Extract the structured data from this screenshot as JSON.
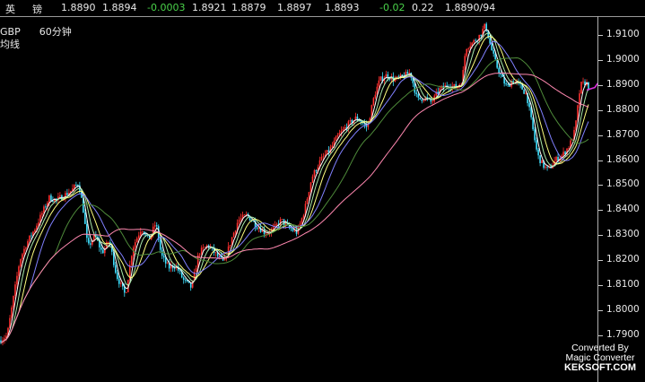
{
  "quote_bar": {
    "fields": [
      {
        "text": "英",
        "color": "#e8e8e8"
      },
      {
        "text": "镑",
        "color": "#e8e8e8"
      },
      {
        "text": "1.8890",
        "color": "#e8e8e8"
      },
      {
        "text": "1.8894",
        "color": "#e8e8e8"
      },
      {
        "text": "-0.0003",
        "color": "#4ad24a"
      },
      {
        "text": "1.8921",
        "color": "#e8e8e8"
      },
      {
        "text": "1.8879",
        "color": "#e8e8e8"
      },
      {
        "text": "1.8897",
        "color": "#e8e8e8"
      },
      {
        "text": "1.8893",
        "color": "#e8e8e8"
      },
      {
        "text": "-0.02",
        "color": "#4ad24a"
      },
      {
        "text": "0.22",
        "color": "#e8e8e8"
      },
      {
        "text": "1.8890/94",
        "color": "#e8e8e8"
      }
    ]
  },
  "chart_title": {
    "symbol": "GBP",
    "period": "60分钟",
    "indicator": "均线"
  },
  "watermark": {
    "line1": "Converted By",
    "line2": "Magic Converter",
    "line3": "KEKSOFT.COM"
  },
  "colors": {
    "background": "#000000",
    "up_candle": "#ff3030",
    "down_candle": "#40e0ff",
    "ma_fast": "#ffffff",
    "ma_2": "#a8e8a8",
    "ma_3": "#ffff80",
    "ma_4": "#8080ff",
    "ma_5": "#4e8a3a",
    "ma_6": "#ff88b0",
    "forecast_arrow": "#e030e0",
    "axis_text": "#e8e8e8"
  },
  "chart_data": {
    "type": "line",
    "title": "",
    "xlabel": "",
    "ylabel": "",
    "ylim": [
      1.7875,
      1.9175
    ],
    "y_ticks": [
      "1.9100",
      "1.9000",
      "1.8900",
      "1.8800",
      "1.8700",
      "1.8600",
      "1.8500",
      "1.8400",
      "1.8300",
      "1.8200",
      "1.8100",
      "1.8000",
      "1.7900"
    ],
    "grid": false,
    "candles_sample": "hourly OHLC bars approximated from price path",
    "price_path": [
      [
        0,
        1.788
      ],
      [
        8,
        1.79
      ],
      [
        15,
        1.805
      ],
      [
        22,
        1.82
      ],
      [
        30,
        1.827
      ],
      [
        38,
        1.832
      ],
      [
        46,
        1.838
      ],
      [
        55,
        1.845
      ],
      [
        63,
        1.844
      ],
      [
        72,
        1.846
      ],
      [
        80,
        1.848
      ],
      [
        88,
        1.851
      ],
      [
        93,
        1.84
      ],
      [
        98,
        1.825
      ],
      [
        106,
        1.83
      ],
      [
        114,
        1.823
      ],
      [
        122,
        1.828
      ],
      [
        130,
        1.814
      ],
      [
        140,
        1.806
      ],
      [
        148,
        1.825
      ],
      [
        158,
        1.833
      ],
      [
        166,
        1.828
      ],
      [
        174,
        1.835
      ],
      [
        180,
        1.822
      ],
      [
        188,
        1.817
      ],
      [
        196,
        1.818
      ],
      [
        205,
        1.812
      ],
      [
        214,
        1.809
      ],
      [
        222,
        1.823
      ],
      [
        232,
        1.826
      ],
      [
        242,
        1.822
      ],
      [
        250,
        1.819
      ],
      [
        258,
        1.828
      ],
      [
        266,
        1.836
      ],
      [
        276,
        1.838
      ],
      [
        286,
        1.834
      ],
      [
        296,
        1.831
      ],
      [
        304,
        1.832
      ],
      [
        314,
        1.836
      ],
      [
        322,
        1.833
      ],
      [
        332,
        1.831
      ],
      [
        340,
        1.84
      ],
      [
        348,
        1.853
      ],
      [
        358,
        1.86
      ],
      [
        368,
        1.864
      ],
      [
        378,
        1.87
      ],
      [
        388,
        1.874
      ],
      [
        398,
        1.877
      ],
      [
        410,
        1.873
      ],
      [
        418,
        1.886
      ],
      [
        424,
        1.892
      ],
      [
        432,
        1.894
      ],
      [
        440,
        1.892
      ],
      [
        448,
        1.893
      ],
      [
        458,
        1.895
      ],
      [
        466,
        1.884
      ],
      [
        474,
        1.885
      ],
      [
        482,
        1.883
      ],
      [
        490,
        1.888
      ],
      [
        500,
        1.89
      ],
      [
        510,
        1.889
      ],
      [
        516,
        1.892
      ],
      [
        520,
        1.905
      ],
      [
        528,
        1.907
      ],
      [
        536,
        1.91
      ],
      [
        542,
        1.914
      ],
      [
        548,
        1.905
      ],
      [
        554,
        1.898
      ],
      [
        560,
        1.893
      ],
      [
        566,
        1.889
      ],
      [
        572,
        1.892
      ],
      [
        580,
        1.89
      ],
      [
        588,
        1.886
      ],
      [
        594,
        1.874
      ],
      [
        600,
        1.862
      ],
      [
        606,
        1.858
      ],
      [
        612,
        1.856
      ],
      [
        620,
        1.86
      ],
      [
        628,
        1.862
      ],
      [
        636,
        1.866
      ],
      [
        642,
        1.872
      ],
      [
        648,
        1.89
      ],
      [
        654,
        1.891
      ],
      [
        658,
        1.889
      ]
    ],
    "series": [
      {
        "type": "ma",
        "color_key": "ma_fast",
        "smoothing": 3
      },
      {
        "type": "ma",
        "color_key": "ma_2",
        "smoothing": 6
      },
      {
        "type": "ma",
        "color_key": "ma_3",
        "smoothing": 10
      },
      {
        "type": "ma",
        "color_key": "ma_4",
        "smoothing": 16
      },
      {
        "type": "ma",
        "color_key": "ma_5",
        "smoothing": 30
      },
      {
        "type": "ma",
        "color_key": "ma_6",
        "smoothing": 60
      }
    ],
    "forecast_path": [
      [
        655,
        1.888
      ],
      [
        664,
        1.889
      ],
      [
        670,
        1.892
      ],
      [
        678,
        1.886
      ],
      [
        685,
        1.878
      ]
    ]
  }
}
